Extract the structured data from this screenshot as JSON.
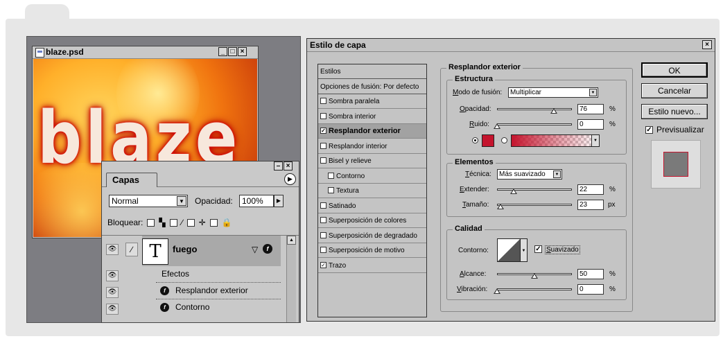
{
  "doc_window": {
    "title": "blaze.psd",
    "canvas_text": "blaze"
  },
  "layers": {
    "tab": "Capas",
    "blend_mode": "Normal",
    "opacity_label": "Opacidad:",
    "opacity_value": "100%",
    "lock_label": "Bloquear:",
    "layer_name": "fuego",
    "thumb_letter": "T",
    "effects_label": "Efectos",
    "effects": [
      "Resplandor exterior",
      "Contorno"
    ]
  },
  "dialog": {
    "title": "Estilo de capa",
    "styles_list": [
      {
        "label": "Estilos",
        "checkbox": false,
        "checked": false,
        "selected": false,
        "indent": false
      },
      {
        "label": "Opciones de fusión: Por defecto",
        "checkbox": false,
        "checked": false,
        "selected": false,
        "indent": false
      },
      {
        "label": "Sombra paralela",
        "checkbox": true,
        "checked": false,
        "selected": false,
        "indent": false
      },
      {
        "label": "Sombra interior",
        "checkbox": true,
        "checked": false,
        "selected": false,
        "indent": false
      },
      {
        "label": "Resplandor exterior",
        "checkbox": true,
        "checked": true,
        "selected": true,
        "indent": false
      },
      {
        "label": "Resplandor interior",
        "checkbox": true,
        "checked": false,
        "selected": false,
        "indent": false
      },
      {
        "label": "Bisel y relieve",
        "checkbox": true,
        "checked": false,
        "selected": false,
        "indent": false
      },
      {
        "label": "Contorno",
        "checkbox": true,
        "checked": false,
        "selected": false,
        "indent": true
      },
      {
        "label": "Textura",
        "checkbox": true,
        "checked": false,
        "selected": false,
        "indent": true
      },
      {
        "label": "Satinado",
        "checkbox": true,
        "checked": false,
        "selected": false,
        "indent": false
      },
      {
        "label": "Superposición de colores",
        "checkbox": true,
        "checked": false,
        "selected": false,
        "indent": false
      },
      {
        "label": "Superposición de degradado",
        "checkbox": true,
        "checked": false,
        "selected": false,
        "indent": false
      },
      {
        "label": "Superposición de motivo",
        "checkbox": true,
        "checked": false,
        "selected": false,
        "indent": false
      },
      {
        "label": "Trazo",
        "checkbox": true,
        "checked": true,
        "selected": false,
        "indent": false
      }
    ],
    "outer_glow": {
      "title": "Resplandor exterior",
      "structure": {
        "title": "Estructura",
        "blend_mode_label": "Modo de fusión:",
        "blend_mode_label_u": "M",
        "blend_mode_label_rest": "odo de fusión:",
        "blend_mode_value": "Multiplicar",
        "opacity_label_u": "O",
        "opacity_label_rest": "pacidad:",
        "opacity_value": "76",
        "opacity_level": 0.76,
        "noise_label_u": "R",
        "noise_label_rest": "uido:",
        "noise_value": "0",
        "noise_level": 0.0,
        "unit_percent": "%",
        "glow_color": "#c4142d"
      },
      "elements": {
        "title": "Elementos",
        "technique_label_u": "T",
        "technique_label_pre": "",
        "technique_label_rest": "écnica:",
        "technique_value": "Más suavizado",
        "spread_label_u": "E",
        "spread_label_rest": "xtender:",
        "spread_value": "22",
        "spread_level": 0.22,
        "size_label_u": "T",
        "size_label_rest": "amaño:",
        "size_value": "23",
        "size_level": 0.05,
        "unit_px": "px",
        "unit_percent": "%"
      },
      "quality": {
        "title": "Calidad",
        "contour_label": "Contorno:",
        "antialias_label_u": "S",
        "antialias_label_rest": "uavizado",
        "antialias_checked": true,
        "range_label_u": "A",
        "range_label_rest": "lcance:",
        "range_value": "50",
        "range_level": 0.5,
        "jitter_label_u": "V",
        "jitter_label_rest": "ibración:",
        "jitter_value": "0",
        "jitter_level": 0.0,
        "unit_percent": "%"
      }
    },
    "buttons": {
      "ok": "OK",
      "cancel": "Cancelar",
      "new_style": "Estilo nuevo...",
      "preview": "Previsualizar"
    },
    "preview_checked": true
  }
}
